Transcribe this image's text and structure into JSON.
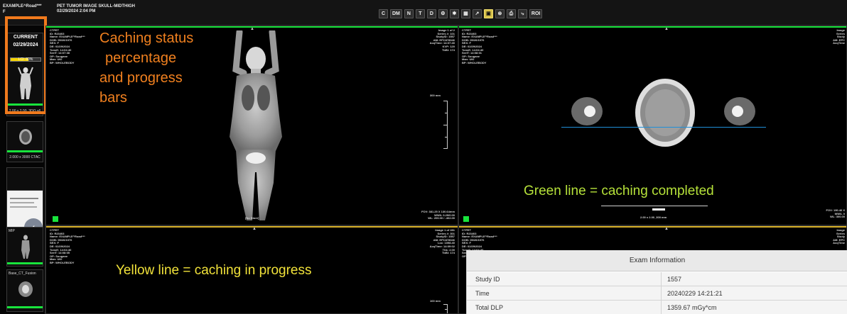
{
  "header": {
    "patient": "EXAMPLE^Road***",
    "patient_line2": "F",
    "study_desc": "PET TUMOR IMAGE SKULL-MIDTHIGH",
    "study_date": "02/29/2024 2:04 PM"
  },
  "toolbar": [
    {
      "label": "C",
      "icon": "contrast-icon"
    },
    {
      "label": "DM",
      "icon": "dm-icon"
    },
    {
      "label": "N",
      "icon": "n-icon"
    },
    {
      "label": "T",
      "icon": "t-icon"
    },
    {
      "label": "D",
      "icon": "d-icon"
    },
    {
      "label": "⚙",
      "icon": "settings-icon"
    },
    {
      "label": "✱",
      "icon": "asterisk-icon"
    },
    {
      "label": "▦",
      "icon": "grid-layout-icon"
    },
    {
      "label": "↗",
      "icon": "pointer-icon"
    },
    {
      "label": "▣",
      "icon": "image-select-icon"
    },
    {
      "label": "⊗",
      "icon": "reference-lines-icon"
    },
    {
      "label": "⎙",
      "icon": "print-icon"
    },
    {
      "label": "⤷",
      "icon": "link-icon"
    },
    {
      "label": "ROI",
      "icon": "roi-icon"
    }
  ],
  "thumbnails": {
    "current": {
      "label": "CURRENT",
      "date": "02/29/2024",
      "cache_percent": 60,
      "cache_text": "LCI: 60%",
      "caption": "2.00 x 2.00_3DO x6"
    },
    "items": [
      {
        "caption": "2.000 x 3000 CTAC",
        "status": "complete"
      },
      {
        "caption": "",
        "status": "complete"
      },
      {
        "caption": "MIP",
        "status": "complete"
      },
      {
        "caption": "Base_CT_Fusion",
        "status": "complete"
      },
      {
        "caption": "",
        "status": "progress"
      }
    ],
    "collapse_icon": "‹"
  },
  "viewports": [
    {
      "status": "complete",
      "left_overlay": "CTPET\nID: R23403\nName: EXAMPLE^Road***\nDOB: 05/26/1976\nSEX: F\nDE: 02/29/2024\nTonsE: 14:04:40\nSeriT: 14:07:38\nOP: Sougane\nMan: UKI\nBP: WHOLEBODY",
      "right_overlay": "Image 1 of 2\nSeries #: 101\nStudyID: 1557\nAM: EPC878046\nAcqTime: 14:07:40\nKVP: 120\nTbBl: 174",
      "bottom_overlay": "FOV: 381.25 X 130.64mm\nWW/L 0.29/0.00\nWL: 200.00 / -402.00",
      "scale_label": "300 mm",
      "center_label": "[No Store]"
    },
    {
      "status": "complete",
      "left_overlay": "CTPET\nID: R23403\nName: EXAMPLE^Road***\nDOB: 05/26/1976\nSEX: F\nDE: 02/29/2024\nTonsE: 14:04:40\nSeriT: 14:08:01\nOP: Sougane\nMan: UKI\nBP: WHOLEBODY",
      "right_overlay": "Image\nSeries\nStudy\nAM: EPC\nAcqTime",
      "bottom_overlay": "FOV: 190.40 X\nWW/L 0\nWL: 300.00",
      "scale_label": "2.00 x 2.00_300 mm",
      "center_label": ""
    },
    {
      "status": "progress",
      "left_overlay": "CTPET\nID: R23403\nName: EXAMPLE^Road***\nDOB: 05/26/1976\nSEX: F\nDE: 02/29/2024\nTonsE: 14:04:40\nSeriT: 14:08:05\nOP: Sougane\nMan: UKI\nBP: WHOLEBODY",
      "right_overlay": "Image 1 of 281\nSeries #: 301\nStudyID: 1557\nAM: EPC878046\nLoc: 1098.40\nAcqTime: 14:09:02\nThk: 2.00\nTbBl: 174",
      "bottom_overlay": "",
      "scale_label": "100 mm",
      "center_label": ""
    },
    {
      "status": "progress",
      "left_overlay": "CTPET\nID: R23403\nName: EXAMPLE^Road***\nDOB: 05/26/1976\nSEX: F\nDE: 02/29/2024\nTonsE: 14:04:40\nSeriT: 14:08:20\nOP: Sougane",
      "right_overlay": "Image\nSeries\nStudy\nAM: EPC\nAcqTime",
      "bottom_overlay": "",
      "scale_label": "",
      "center_label": ""
    }
  ],
  "annotations": {
    "caching": [
      "Caching status",
      "percentage",
      "and progress",
      "bars"
    ],
    "green": "Green line = caching completed",
    "yellow": "Yellow line = caching in progress"
  },
  "exam_info": {
    "title": "Exam Information",
    "rows": [
      {
        "key": "Study ID",
        "value": "1557"
      },
      {
        "key": "Time",
        "value": "20240229 14:21:21"
      },
      {
        "key": "Total DLP",
        "value": "1359.67 mGy*cm"
      }
    ]
  },
  "colors": {
    "status_complete": "#18e43c",
    "status_progress": "#d8b12a",
    "accent_highlight": "#f07a1d"
  }
}
